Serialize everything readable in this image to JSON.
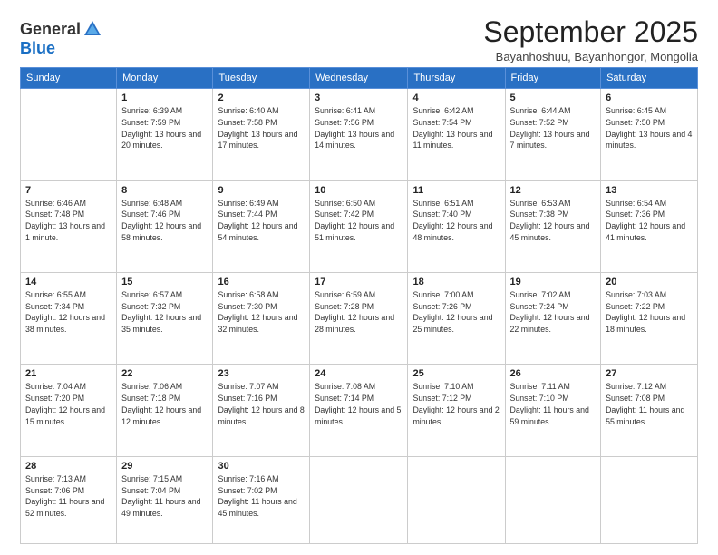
{
  "logo": {
    "general": "General",
    "blue": "Blue"
  },
  "title": "September 2025",
  "subtitle": "Bayanhoshuu, Bayanhongor, Mongolia",
  "days": [
    "Sunday",
    "Monday",
    "Tuesday",
    "Wednesday",
    "Thursday",
    "Friday",
    "Saturday"
  ],
  "weeks": [
    [
      {
        "day": "",
        "sunrise": "",
        "sunset": "",
        "daylight": ""
      },
      {
        "day": "1",
        "sunrise": "Sunrise: 6:39 AM",
        "sunset": "Sunset: 7:59 PM",
        "daylight": "Daylight: 13 hours and 20 minutes."
      },
      {
        "day": "2",
        "sunrise": "Sunrise: 6:40 AM",
        "sunset": "Sunset: 7:58 PM",
        "daylight": "Daylight: 13 hours and 17 minutes."
      },
      {
        "day": "3",
        "sunrise": "Sunrise: 6:41 AM",
        "sunset": "Sunset: 7:56 PM",
        "daylight": "Daylight: 13 hours and 14 minutes."
      },
      {
        "day": "4",
        "sunrise": "Sunrise: 6:42 AM",
        "sunset": "Sunset: 7:54 PM",
        "daylight": "Daylight: 13 hours and 11 minutes."
      },
      {
        "day": "5",
        "sunrise": "Sunrise: 6:44 AM",
        "sunset": "Sunset: 7:52 PM",
        "daylight": "Daylight: 13 hours and 7 minutes."
      },
      {
        "day": "6",
        "sunrise": "Sunrise: 6:45 AM",
        "sunset": "Sunset: 7:50 PM",
        "daylight": "Daylight: 13 hours and 4 minutes."
      }
    ],
    [
      {
        "day": "7",
        "sunrise": "Sunrise: 6:46 AM",
        "sunset": "Sunset: 7:48 PM",
        "daylight": "Daylight: 13 hours and 1 minute."
      },
      {
        "day": "8",
        "sunrise": "Sunrise: 6:48 AM",
        "sunset": "Sunset: 7:46 PM",
        "daylight": "Daylight: 12 hours and 58 minutes."
      },
      {
        "day": "9",
        "sunrise": "Sunrise: 6:49 AM",
        "sunset": "Sunset: 7:44 PM",
        "daylight": "Daylight: 12 hours and 54 minutes."
      },
      {
        "day": "10",
        "sunrise": "Sunrise: 6:50 AM",
        "sunset": "Sunset: 7:42 PM",
        "daylight": "Daylight: 12 hours and 51 minutes."
      },
      {
        "day": "11",
        "sunrise": "Sunrise: 6:51 AM",
        "sunset": "Sunset: 7:40 PM",
        "daylight": "Daylight: 12 hours and 48 minutes."
      },
      {
        "day": "12",
        "sunrise": "Sunrise: 6:53 AM",
        "sunset": "Sunset: 7:38 PM",
        "daylight": "Daylight: 12 hours and 45 minutes."
      },
      {
        "day": "13",
        "sunrise": "Sunrise: 6:54 AM",
        "sunset": "Sunset: 7:36 PM",
        "daylight": "Daylight: 12 hours and 41 minutes."
      }
    ],
    [
      {
        "day": "14",
        "sunrise": "Sunrise: 6:55 AM",
        "sunset": "Sunset: 7:34 PM",
        "daylight": "Daylight: 12 hours and 38 minutes."
      },
      {
        "day": "15",
        "sunrise": "Sunrise: 6:57 AM",
        "sunset": "Sunset: 7:32 PM",
        "daylight": "Daylight: 12 hours and 35 minutes."
      },
      {
        "day": "16",
        "sunrise": "Sunrise: 6:58 AM",
        "sunset": "Sunset: 7:30 PM",
        "daylight": "Daylight: 12 hours and 32 minutes."
      },
      {
        "day": "17",
        "sunrise": "Sunrise: 6:59 AM",
        "sunset": "Sunset: 7:28 PM",
        "daylight": "Daylight: 12 hours and 28 minutes."
      },
      {
        "day": "18",
        "sunrise": "Sunrise: 7:00 AM",
        "sunset": "Sunset: 7:26 PM",
        "daylight": "Daylight: 12 hours and 25 minutes."
      },
      {
        "day": "19",
        "sunrise": "Sunrise: 7:02 AM",
        "sunset": "Sunset: 7:24 PM",
        "daylight": "Daylight: 12 hours and 22 minutes."
      },
      {
        "day": "20",
        "sunrise": "Sunrise: 7:03 AM",
        "sunset": "Sunset: 7:22 PM",
        "daylight": "Daylight: 12 hours and 18 minutes."
      }
    ],
    [
      {
        "day": "21",
        "sunrise": "Sunrise: 7:04 AM",
        "sunset": "Sunset: 7:20 PM",
        "daylight": "Daylight: 12 hours and 15 minutes."
      },
      {
        "day": "22",
        "sunrise": "Sunrise: 7:06 AM",
        "sunset": "Sunset: 7:18 PM",
        "daylight": "Daylight: 12 hours and 12 minutes."
      },
      {
        "day": "23",
        "sunrise": "Sunrise: 7:07 AM",
        "sunset": "Sunset: 7:16 PM",
        "daylight": "Daylight: 12 hours and 8 minutes."
      },
      {
        "day": "24",
        "sunrise": "Sunrise: 7:08 AM",
        "sunset": "Sunset: 7:14 PM",
        "daylight": "Daylight: 12 hours and 5 minutes."
      },
      {
        "day": "25",
        "sunrise": "Sunrise: 7:10 AM",
        "sunset": "Sunset: 7:12 PM",
        "daylight": "Daylight: 12 hours and 2 minutes."
      },
      {
        "day": "26",
        "sunrise": "Sunrise: 7:11 AM",
        "sunset": "Sunset: 7:10 PM",
        "daylight": "Daylight: 11 hours and 59 minutes."
      },
      {
        "day": "27",
        "sunrise": "Sunrise: 7:12 AM",
        "sunset": "Sunset: 7:08 PM",
        "daylight": "Daylight: 11 hours and 55 minutes."
      }
    ],
    [
      {
        "day": "28",
        "sunrise": "Sunrise: 7:13 AM",
        "sunset": "Sunset: 7:06 PM",
        "daylight": "Daylight: 11 hours and 52 minutes."
      },
      {
        "day": "29",
        "sunrise": "Sunrise: 7:15 AM",
        "sunset": "Sunset: 7:04 PM",
        "daylight": "Daylight: 11 hours and 49 minutes."
      },
      {
        "day": "30",
        "sunrise": "Sunrise: 7:16 AM",
        "sunset": "Sunset: 7:02 PM",
        "daylight": "Daylight: 11 hours and 45 minutes."
      },
      {
        "day": "",
        "sunrise": "",
        "sunset": "",
        "daylight": ""
      },
      {
        "day": "",
        "sunrise": "",
        "sunset": "",
        "daylight": ""
      },
      {
        "day": "",
        "sunrise": "",
        "sunset": "",
        "daylight": ""
      },
      {
        "day": "",
        "sunrise": "",
        "sunset": "",
        "daylight": ""
      }
    ]
  ]
}
